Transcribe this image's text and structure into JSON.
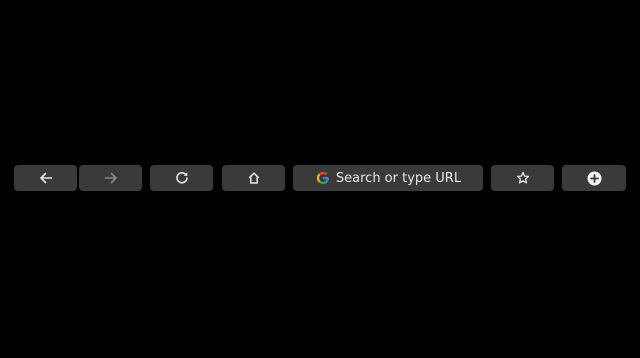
{
  "touchbar": {
    "back": {
      "icon": "arrow-left-icon",
      "enabled": true
    },
    "forward": {
      "icon": "arrow-right-icon",
      "enabled": false
    },
    "reload": {
      "icon": "reload-icon",
      "enabled": true
    },
    "home": {
      "icon": "home-icon",
      "enabled": true
    },
    "search": {
      "icon": "google-g-icon",
      "placeholder": "Search or type URL"
    },
    "bookmark": {
      "icon": "star-icon",
      "enabled": true
    },
    "new_tab": {
      "icon": "plus-circle-icon",
      "enabled": true
    }
  },
  "colors": {
    "background": "#000000",
    "button": "#3a3a3a",
    "icon": "#e8e8e8",
    "google_blue": "#4285F4",
    "google_red": "#EA4335",
    "google_yellow": "#FBBC05",
    "google_green": "#34A853"
  }
}
